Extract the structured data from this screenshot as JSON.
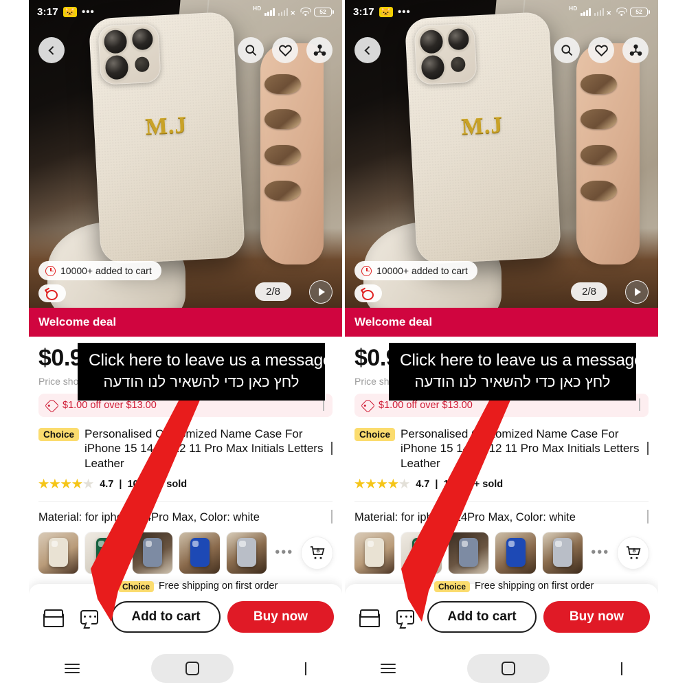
{
  "status_bar": {
    "time": "3:17",
    "emoji_icon": "cat-emoji-icon",
    "dots": "•••",
    "network_label": "HD",
    "battery_percent": "52"
  },
  "hero": {
    "back_icon": "back-chevron-icon",
    "search_icon": "search-icon",
    "wishlist_icon": "heart-icon",
    "share_icon": "share-icon",
    "monogram": "M.J",
    "added_to_cart_badge": "10000+ added to cart",
    "pager": "2/8",
    "play_icon": "play-icon"
  },
  "welcome_bar": {
    "label": "Welcome deal"
  },
  "price": {
    "value": "$0.99",
    "note": "Price shown"
  },
  "coupon": {
    "label": "$1.00 off over $13.00",
    "tag_icon": "price-tag-icon",
    "chevron_icon": "chevron-right-icon"
  },
  "product": {
    "choice_badge": "Choice",
    "title": "Personalised Customized Name Case For iPhone 15 14 13 12 11 Pro Max Initials Letters Leather",
    "expand_icon": "chevron-down-icon",
    "rating_value": "4.7",
    "rating_separator": "|",
    "sold_count": "10,000+ sold",
    "stars": "★★★★",
    "star_dim": "★"
  },
  "variant": {
    "label": "Material: for iphone 14Pro Max, Color: white",
    "chevron_icon": "chevron-right-icon",
    "more_dots": "•••",
    "cart_icon": "shopping-cart-icon",
    "cart_count": "8",
    "thumbs": [
      {
        "name": "thumb-white-case",
        "case_color": "#e9e2d3",
        "bg": "linear-gradient(150deg,#d9cbb8 0%,#b99b79 55%,#4a3424 100%)"
      },
      {
        "name": "thumb-green-case",
        "case_color": "#16613f",
        "bg": "linear-gradient(150deg,#efeae2 0%,#d8d2c6 60%,#b4aa9a 100%)"
      },
      {
        "name": "thumb-grayblue-case",
        "case_color": "#7d8ba3",
        "bg": "linear-gradient(150deg,#3a2d22 0%,#6a5542 55%,#cfc3b0 100%)"
      },
      {
        "name": "thumb-blue-case",
        "case_color": "#1d49b5",
        "bg": "linear-gradient(150deg,#cdbfa9 0%,#8a6a4c 55%,#43301f 100%)"
      },
      {
        "name": "thumb-lightgray-case",
        "case_color": "#b9bec7",
        "bg": "linear-gradient(150deg,#d8cdba 0%,#8a6c4e 50%,#3c2a1b 100%)"
      }
    ]
  },
  "bottom_bar": {
    "shipping_badge": "Choice",
    "shipping_note": "Free shipping on first order",
    "store_icon": "store-icon",
    "chat_icon": "chat-bubble-icon",
    "add_to_cart": "Add to cart",
    "buy_now": "Buy now"
  },
  "nav_bar": {
    "recents_icon": "menu-icon",
    "home_icon": "home-square-icon",
    "back_icon": "back-chevron-icon"
  },
  "annotation": {
    "line_en": "Click here to leave us a message",
    "line_he": "לחץ כאן כדי להשאיר לנו הודעה",
    "arrow_color": "#e81c1c",
    "arrow_target": "chat-bubble-icon"
  },
  "colors": {
    "brand_red": "#d0053f",
    "buy_red": "#e01a26",
    "choice_yellow": "#fbdc6e",
    "coupon_pink": "#fdeef0",
    "star_yellow": "#f5c518"
  }
}
